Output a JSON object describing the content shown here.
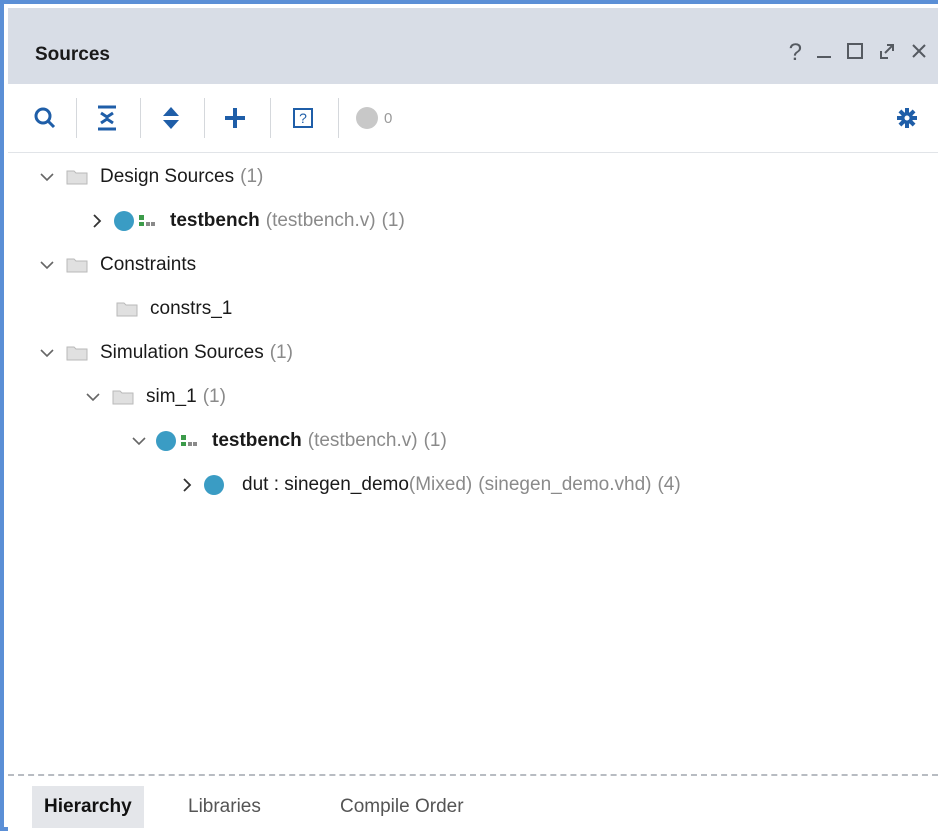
{
  "panel": {
    "title": "Sources",
    "controls": {
      "help": "?",
      "minimize": "_",
      "maximize": "□",
      "float": "⇗",
      "close": "✕"
    }
  },
  "toolbar": {
    "search_icon": "search-icon",
    "collapse_all_icon": "collapse-all-icon",
    "expand_all_icon": "expand-all-icon",
    "add_icon": "plus-icon",
    "help_icon": "help-box-icon",
    "status_count": "0",
    "settings_icon": "gear-icon"
  },
  "tree": {
    "design_sources": {
      "label": "Design Sources",
      "count": "(1)"
    },
    "design_testbench": {
      "name": "testbench",
      "file": "(testbench.v)",
      "count": "(1)"
    },
    "constraints": {
      "label": "Constraints"
    },
    "constrs_1": {
      "label": "constrs_1"
    },
    "simulation_sources": {
      "label": "Simulation Sources",
      "count": "(1)"
    },
    "sim_1": {
      "label": "sim_1",
      "count": "(1)"
    },
    "sim_testbench": {
      "name": "testbench",
      "file": "(testbench.v)",
      "count": "(1)"
    },
    "dut": {
      "name": "dut : sinegen_demo",
      "type": "(Mixed)",
      "file": "(sinegen_demo.vhd)",
      "count": "(4)"
    }
  },
  "tabs": [
    {
      "label": "Hierarchy",
      "active": true
    },
    {
      "label": "Libraries",
      "active": false
    },
    {
      "label": "Compile Order",
      "active": false
    }
  ],
  "colors": {
    "frame_border": "#5b8fd6",
    "title_bg": "#d8dde6",
    "module_dot": "#3a9cc4",
    "hier_icon_green": "#3c9b4a",
    "muted_text": "#8a8a8a"
  }
}
